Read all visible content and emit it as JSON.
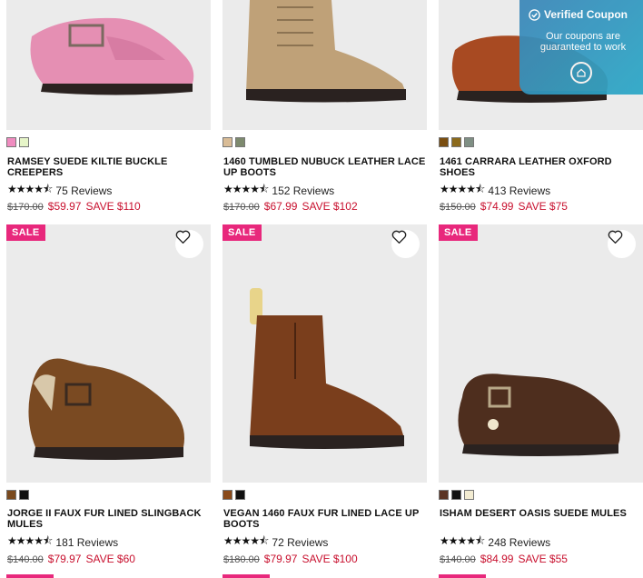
{
  "coupon": {
    "title": "Verified Coupon",
    "subtitle": "Our coupons are guaranteed to work",
    "accent": "#2aa8c7"
  },
  "colors": {
    "sale_badge": "#e8287c",
    "sale_price": "#c8102e"
  },
  "products": [
    {
      "name": "RAMSEY SUEDE KILTIE BUCKLE CREEPERS",
      "reviews": "75 Reviews",
      "old_price": "$170.00",
      "new_price": "$59.97",
      "save": "SAVE $110",
      "swatches": [
        "#f08cc0",
        "#e6f5c8"
      ],
      "rating": 4.5,
      "sale": ""
    },
    {
      "name": "1460 TUMBLED NUBUCK LEATHER LACE UP BOOTS",
      "reviews": "152 Reviews",
      "old_price": "$170.00",
      "new_price": "$67.99",
      "save": "SAVE $102",
      "swatches": [
        "#d9bc96",
        "#7d8a6e"
      ],
      "rating": 4.5,
      "sale": ""
    },
    {
      "name": "1461 CARRARA LEATHER OXFORD SHOES",
      "reviews": "413 Reviews",
      "old_price": "$150.00",
      "new_price": "$74.99",
      "save": "SAVE $75",
      "swatches": [
        "#7a4e10",
        "#8b6a1c",
        "#7f8f84"
      ],
      "rating": 4.5,
      "sale": ""
    },
    {
      "name": "JORGE II FAUX FUR LINED SLINGBACK MULES",
      "reviews": "181 Reviews",
      "old_price": "$140.00",
      "new_price": "$79.97",
      "save": "SAVE $60",
      "swatches": [
        "#7a4a1e",
        "#111111"
      ],
      "rating": 4.5,
      "sale": "SALE"
    },
    {
      "name": "VEGAN 1460 FAUX FUR LINED LACE UP BOOTS",
      "reviews": "72 Reviews",
      "old_price": "$180.00",
      "new_price": "$79.97",
      "save": "SAVE $100",
      "swatches": [
        "#8a4a1a",
        "#111111"
      ],
      "rating": 4.5,
      "sale": "SALE"
    },
    {
      "name": "ISHAM DESERT OASIS SUEDE MULES",
      "reviews": "248 Reviews",
      "old_price": "$140.00",
      "new_price": "$84.99",
      "save": "SAVE $55",
      "swatches": [
        "#5a3424",
        "#111111",
        "#f3ecd2"
      ],
      "rating": 4.5,
      "sale": "SALE"
    }
  ],
  "stars_glyph": "★★★★⯪"
}
